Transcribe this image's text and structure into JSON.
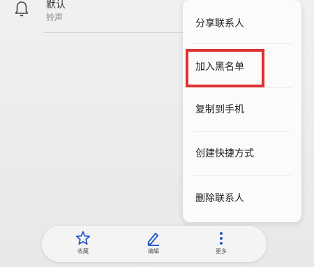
{
  "ringtone": {
    "title": "默认",
    "subtitle": "铃声"
  },
  "menu": {
    "items": [
      {
        "label": "分享联系人"
      },
      {
        "label": "加入黑名单"
      },
      {
        "label": "复制到手机"
      },
      {
        "label": "创建快捷方式"
      },
      {
        "label": "删除联系人"
      }
    ]
  },
  "bottom_bar": {
    "favorite": "收藏",
    "edit": "编辑",
    "more": "更多"
  },
  "colors": {
    "highlight": "#e03030",
    "icon": "#2a57c8"
  },
  "icons": [
    "bell-icon",
    "star-icon",
    "pencil-icon",
    "more-vertical-icon"
  ]
}
